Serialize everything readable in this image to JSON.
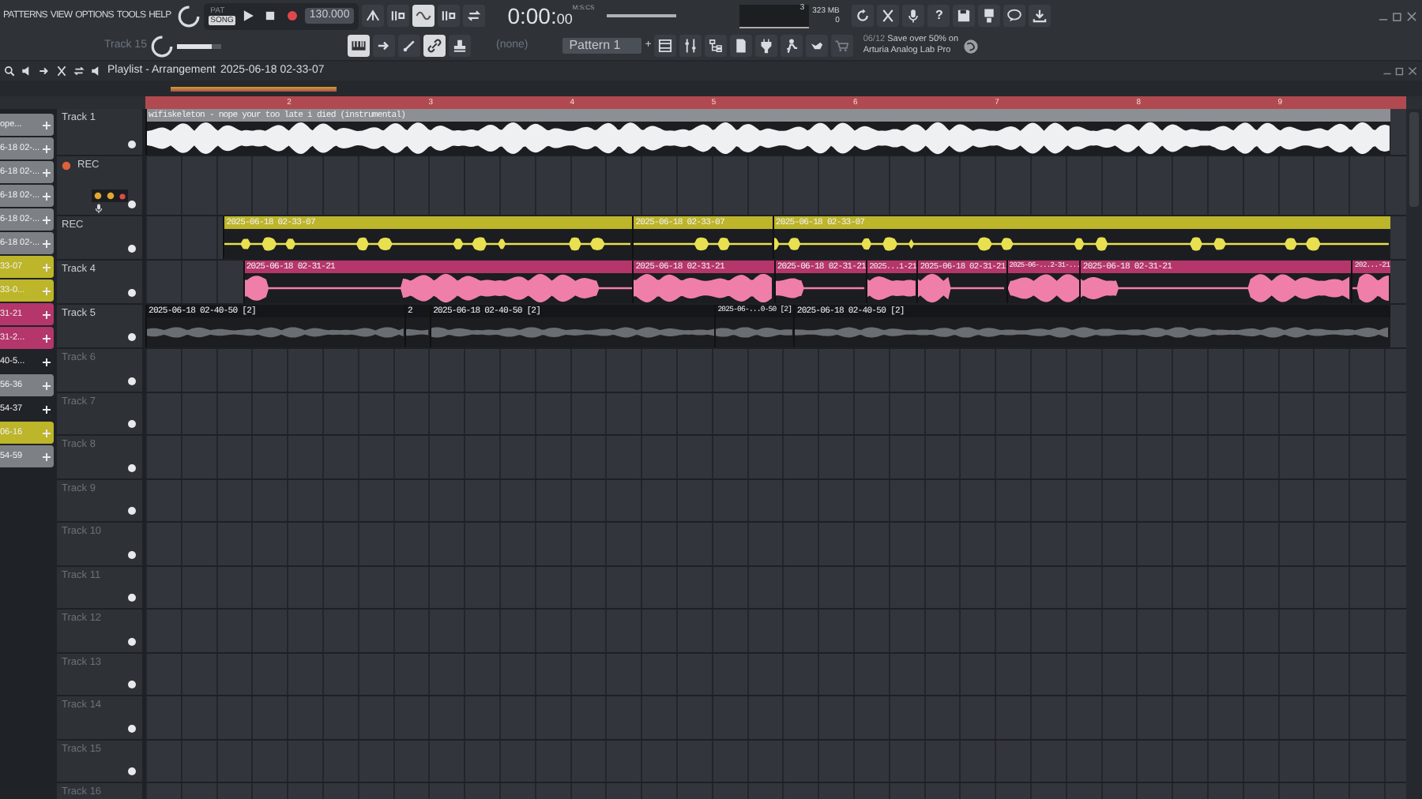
{
  "menu": [
    "PATTERNS",
    "VIEW",
    "OPTIONS",
    "TOOLS",
    "HELP"
  ],
  "modes": [
    {
      "label": "PAT",
      "selected": false
    },
    {
      "label": "SONG",
      "selected": true
    }
  ],
  "tempo": "130.000",
  "time": {
    "main": "0:00:",
    "fraction": "00",
    "unit": "M:S:CS"
  },
  "memory": {
    "value": "3",
    "mb": "323 MB",
    "voices": "0"
  },
  "help_glyph": "?",
  "channel": "Track 15",
  "channel_volume": {
    "level": 0.8
  },
  "pattern_picker": "(none)",
  "pattern": "Pattern 1",
  "pattern_add": "+",
  "hint": {
    "counter": "06/12",
    "line1": "Save over 50% on",
    "line2": "Arturia Analog Lab Pro"
  },
  "playlist": {
    "title": "Playlist - Arrangement",
    "breadcrumb": "2025-06-18 02-33-07",
    "ruler": [
      "2",
      "3",
      "4",
      "5",
      "6",
      "7",
      "8",
      "9"
    ],
    "picker": [
      {
        "label": "ope...",
        "color": "#7d8186"
      },
      {
        "label": "6-18 02-...",
        "color": "#7d8186"
      },
      {
        "label": "6-18 02-...",
        "color": "#7d8186"
      },
      {
        "label": "6-18 02-...",
        "color": "#7d8186"
      },
      {
        "label": "6-18 02-...",
        "color": "#7d8186"
      },
      {
        "label": "6-18 02-...",
        "color": "#7d8186"
      },
      {
        "label": "33-07",
        "color": "#bdb52a"
      },
      {
        "label": "33-0...",
        "color": "#bdb52a"
      },
      {
        "label": "31-21",
        "color": "#b5366a"
      },
      {
        "label": "31-2...",
        "color": "#b5366a"
      },
      {
        "label": "40-5...",
        "color": "#202327"
      },
      {
        "label": "56-36",
        "color": "#7d8186"
      },
      {
        "label": "54-37",
        "color": "#202327"
      },
      {
        "label": "06-16",
        "color": "#bdb52a"
      },
      {
        "label": "54-59",
        "color": "#7d8186"
      }
    ],
    "tracks": [
      {
        "name": "Track 1",
        "kind": "track",
        "dimmed": false,
        "clips": [
          {
            "label": "wifiskeleton - nope your too late i died (instrumental)",
            "color": "#8c8f93"
          }
        ]
      },
      {
        "name": "REC",
        "kind": "armed",
        "dimmed": false
      },
      {
        "name": "REC",
        "kind": "track",
        "dimmed": false,
        "clips": [
          {
            "label": "2025-06-18 02-33-07",
            "color": "#bdb52a"
          },
          {
            "label": "2025-06-18 02-33-07",
            "color": "#bdb52a"
          },
          {
            "label": "2025-06-18 02-33-07",
            "color": "#bdb52a"
          }
        ]
      },
      {
        "name": "Track 4",
        "kind": "track",
        "dimmed": false,
        "clips": [
          {
            "label": "2025-06-18 02-31-21",
            "color": "#b5366a"
          },
          {
            "label": "2025-06-18 02-31-21",
            "color": "#b5366a"
          },
          {
            "label": "2025-06-18 02-31-21",
            "color": "#b5366a"
          },
          {
            "label": "2025...1-21",
            "color": "#b5366a"
          },
          {
            "label": "2025-06-18 02-31-21",
            "color": "#b5366a"
          },
          {
            "label": "2025-06-...2-31-...",
            "color": "#b5366a"
          },
          {
            "label": "2025-06-18 02-31-21",
            "color": "#b5366a"
          },
          {
            "label": "202...-21",
            "color": "#b5366a"
          }
        ]
      },
      {
        "name": "Track 5",
        "kind": "track",
        "dimmed": false,
        "clips": [
          {
            "label": "2025-06-18 02-40-50 [2]",
            "color": "#141619"
          },
          {
            "label": "2",
            "color": "#141619"
          },
          {
            "label": "2025-06-18 02-40-50 [2]",
            "color": "#141619"
          },
          {
            "label": "2025-06-...0-50 [2]",
            "color": "#141619"
          },
          {
            "label": "2025-06-18 02-40-50 [2]",
            "color": "#141619"
          }
        ]
      },
      {
        "name": "Track 6",
        "kind": "track",
        "dimmed": true
      },
      {
        "name": "Track 7",
        "kind": "track",
        "dimmed": true
      },
      {
        "name": "Track 8",
        "kind": "track",
        "dimmed": true
      },
      {
        "name": "Track 9",
        "kind": "track",
        "dimmed": true
      },
      {
        "name": "Track 10",
        "kind": "track",
        "dimmed": true
      },
      {
        "name": "Track 11",
        "kind": "track",
        "dimmed": true
      },
      {
        "name": "Track 12",
        "kind": "track",
        "dimmed": true
      },
      {
        "name": "Track 13",
        "kind": "track",
        "dimmed": true
      },
      {
        "name": "Track 14",
        "kind": "track",
        "dimmed": true
      },
      {
        "name": "Track 15",
        "kind": "track",
        "dimmed": true
      },
      {
        "name": "Track 16",
        "kind": "track",
        "dimmed": true
      }
    ]
  }
}
